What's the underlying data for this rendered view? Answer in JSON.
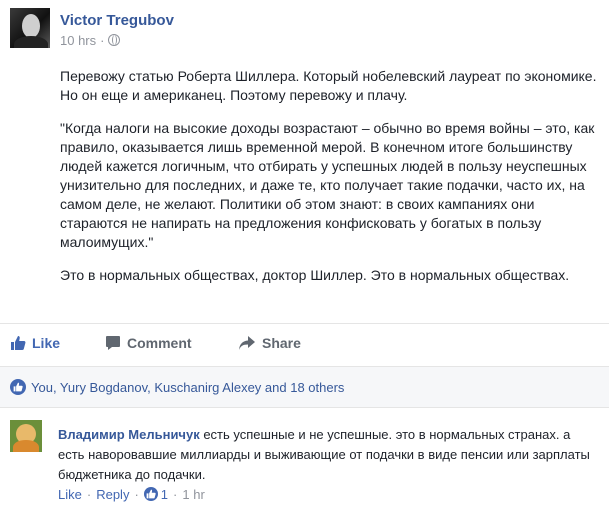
{
  "post": {
    "author": "Victor Tregubov",
    "time": "10 hrs",
    "dot": "·",
    "paragraphs": [
      "Перевожу статью Роберта Шиллера. Который нобелевский лауреат по экономике. Но он еще и американец. Поэтому перевожу и плачу.",
      "\"Когда налоги на высокие доходы возрастают – обычно во время войны – это, как правило, оказывается лишь временной мерой. В конечном итоге большинству людей кажется логичным, что отбирать у успешных людей в пользу неуспешных унизительно для последних, и даже те, кто получает такие подачки, часто их, на самом деле, не желают. Политики об этом знают: в своих кампаниях они стараются не напирать на предложения конфисковать у богатых в пользу малоимущих.\"",
      "Это в нормальных обществах, доктор Шиллер. Это в нормальных обществах."
    ]
  },
  "actions": {
    "like": "Like",
    "comment": "Comment",
    "share": "Share"
  },
  "reactions": {
    "text": "You, Yury Bogdanov, Kuschanirg Alexey and 18 others"
  },
  "comment": {
    "author": "Владимир Мельничук",
    "text": " есть успешные и не успешные. это в нормальных странах. а есть наворовавшие миллиарды и выживающие от подачки в виде пенсии или зарплаты бюджетника до подачки.",
    "like": "Like",
    "reply": "Reply",
    "sep": "·",
    "like_count": "1",
    "time": "1 hr"
  },
  "colors": {
    "link": "#365899",
    "accent": "#4267b2",
    "muted": "#90949c",
    "text": "#1d2129"
  }
}
